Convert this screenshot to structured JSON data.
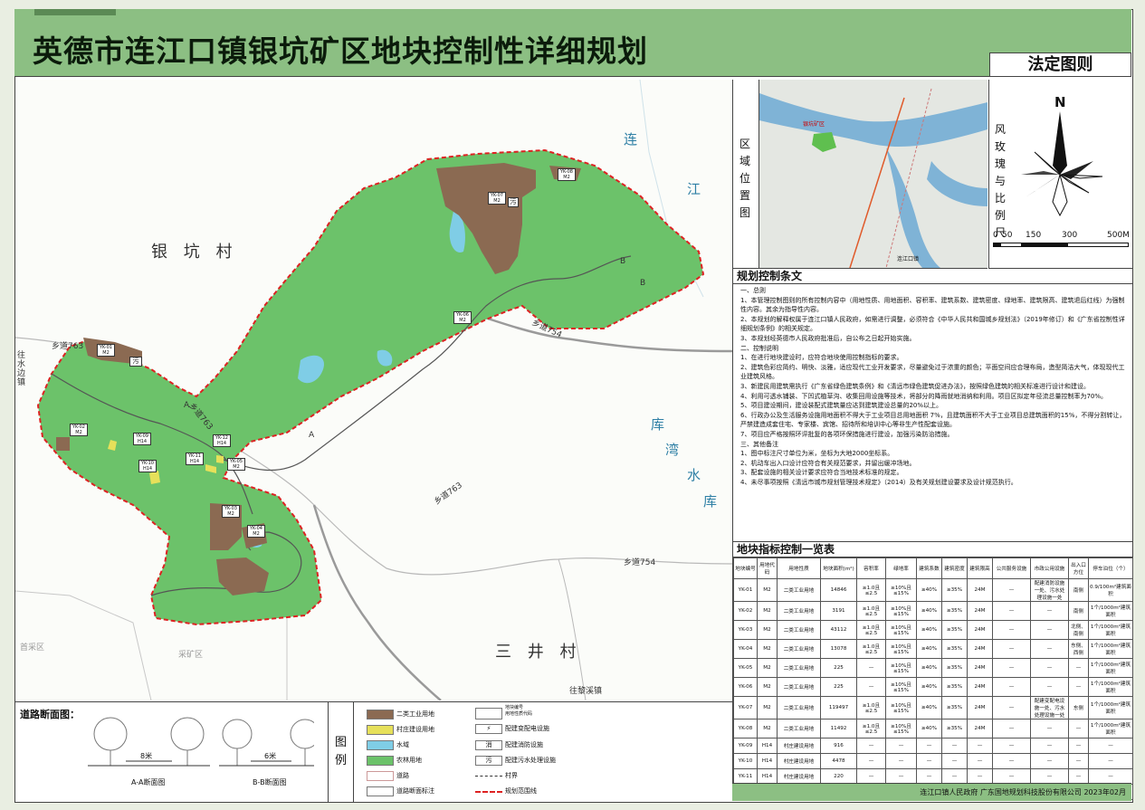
{
  "title": "英德市连江口镇银坑矿区地块控制性详细规划",
  "subtitle": "法定图则",
  "map": {
    "place_labels": [
      "银 坑 村",
      "三 井 村"
    ],
    "river_labels": [
      "连",
      "江",
      "库",
      "湾",
      "水",
      "库"
    ],
    "edge_labels": [
      "往水边镇",
      "首采区",
      "采矿区",
      "往黎溪镇"
    ],
    "road_labels": [
      "乡道763",
      "乡道763",
      "乡道754",
      "乡道763",
      "乡道754"
    ],
    "plot_labels": [
      {
        "code": "YK-01",
        "use": "M2"
      },
      {
        "code": "YK-02",
        "use": "M2"
      },
      {
        "code": "YK-03",
        "use": "M2"
      },
      {
        "code": "YK-04",
        "use": "M2"
      },
      {
        "code": "YK-05",
        "use": "M2"
      },
      {
        "code": "YK-06",
        "use": "M2"
      },
      {
        "code": "YK-07",
        "use": "M2"
      },
      {
        "code": "YK-08",
        "use": "M2"
      },
      {
        "code": "YK-09",
        "use": "H14"
      },
      {
        "code": "YK-10",
        "use": "H14"
      },
      {
        "code": "YK-11",
        "use": "H14"
      },
      {
        "code": "YK-12",
        "use": "H14"
      }
    ],
    "facility_badges": [
      "污",
      "污"
    ],
    "section_marks": [
      "A",
      "A",
      "B",
      "B"
    ]
  },
  "location_map": {
    "label": "区域位置图",
    "place_label": "银坑矿区",
    "town_label": "连江口镇"
  },
  "compass": {
    "label": "风玫瑰与比例尺",
    "north": "N",
    "scale_ticks": [
      "0",
      "50",
      "150",
      "300",
      "500M"
    ]
  },
  "provisions": {
    "heading": "规划控制条文",
    "lines": [
      "一、总则",
      "1、本管理控制图则的所有控制内容中（用地性质、用地面积、容积率、建筑系数、建筑密度、绿地率、建筑限高、建筑退后红线）为强制性内容。其余为指导性内容。",
      "2、本规划的解释权属于连江口镇人民政府，如需进行调整，必须符合《中华人民共和国城乡规划法》（2019年修订）和《广东省控制性详细规划条例》的相关规定。",
      "3、本规划经英德市人民政府批准后，自公布之日起开始实施。",
      "二、控制说明",
      "1、在进行地块建设时，应符合地块使用控制指标的要求。",
      "2、建筑色彩应简约、明快、淡雅，适应现代工业开发要求，尽量避免过于浓重的颜色；平面空间应合理布局，造型简洁大气，体现现代工业建筑风格。",
      "3、新建民用建筑需执行《广东省绿色建筑条例》和《清远市绿色建筑促进办法》，按照绿色建筑的相关标准进行设计和建设。",
      "4、利用可透水铺装、下凹式植草沟、收集回用设施等技术，将部分的降雨就地消纳和利用。项目区拟定年径流总量控制率为70%。",
      "5、项目建设期间，建设装配式建筑量应达到建筑建设总量的20%以上。",
      "6、行政办公及生活服务设施用地面积不得大于工业项目总用地面积 7%，且建筑面积不大于工业项目总建筑面积的15%，不得分割转让，严禁建造成套住宅、专家楼、宾馆、招待所和培训中心等非生产性配套设施。",
      "7、项目应严格按照环评批复的各项环保措施进行建设，加强污染防治措施。",
      "三、其他备注",
      "1、图中标注尺寸单位为米，坐标为大地2000坐标系。",
      "2、机动车出入口设计应符合有关规范要求，并留出缓冲场地。",
      "3、配套设施的相关设计要求应符合当地技术标准的规定。",
      "4、未尽事项按照《清远市城市规划管理技术规定》（2014）及有关规划建设要求及设计规范执行。"
    ]
  },
  "table": {
    "heading": "地块指标控制一览表",
    "columns": [
      "地块编号",
      "用地代码",
      "用地性质",
      "地块面积(m²)",
      "容积率",
      "绿地率",
      "建筑系数",
      "建筑密度",
      "建筑限高",
      "公共服务设施",
      "市政公用设施",
      "出入口方位",
      "停车泊位（个）"
    ],
    "rows": [
      [
        "YK-01",
        "M2",
        "二类工业用地",
        "14846",
        "≥1.0且≤2.5",
        "≥10%且≤15%",
        "≥40%",
        "≥35%",
        "24M",
        "—",
        "配建消防设施一处、污水处理设施一处",
        "南侧",
        "0.9/100m²建筑面积"
      ],
      [
        "YK-02",
        "M2",
        "二类工业用地",
        "3191",
        "≥1.0且≤2.5",
        "≥10%且≤15%",
        "≥40%",
        "≥35%",
        "24M",
        "—",
        "—",
        "南侧",
        "1个/1000m²建筑面积"
      ],
      [
        "YK-03",
        "M2",
        "二类工业用地",
        "43112",
        "≥1.0且≤2.5",
        "≥10%且≤15%",
        "≥40%",
        "≥35%",
        "24M",
        "—",
        "—",
        "北侧、南侧",
        "1个/1000m²建筑面积"
      ],
      [
        "YK-04",
        "M2",
        "二类工业用地",
        "13078",
        "≥1.0且≤2.5",
        "≥10%且≤15%",
        "≥40%",
        "≥35%",
        "24M",
        "—",
        "—",
        "东侧、西侧",
        "1个/1000m²建筑面积"
      ],
      [
        "YK-05",
        "M2",
        "二类工业用地",
        "225",
        "—",
        "≥10%且≤15%",
        "≥40%",
        "≥35%",
        "24M",
        "—",
        "—",
        "—",
        "1个/1000m²建筑面积"
      ],
      [
        "YK-06",
        "M2",
        "二类工业用地",
        "225",
        "—",
        "≥10%且≤15%",
        "≥40%",
        "≥35%",
        "24M",
        "—",
        "—",
        "—",
        "1个/1000m²建筑面积"
      ],
      [
        "YK-07",
        "M2",
        "二类工业用地",
        "119497",
        "≥1.0且≤2.5",
        "≥10%且≤15%",
        "≥40%",
        "≥35%",
        "24M",
        "—",
        "配建变配电设施一处、污水处理设施一处",
        "东侧",
        "1个/1000m²建筑面积"
      ],
      [
        "YK-08",
        "M2",
        "二类工业用地",
        "11492",
        "≥1.0且≤2.5",
        "≥10%且≤15%",
        "≥40%",
        "≥35%",
        "24M",
        "—",
        "—",
        "—",
        "1个/1000m²建筑面积"
      ],
      [
        "YK-09",
        "H14",
        "村庄建设用地",
        "916",
        "—",
        "—",
        "—",
        "—",
        "—",
        "—",
        "—",
        "—",
        "—"
      ],
      [
        "YK-10",
        "H14",
        "村庄建设用地",
        "4478",
        "—",
        "—",
        "—",
        "—",
        "—",
        "—",
        "—",
        "—",
        "—"
      ],
      [
        "YK-11",
        "H14",
        "村庄建设用地",
        "220",
        "—",
        "—",
        "—",
        "—",
        "—",
        "—",
        "—",
        "—",
        "—"
      ],
      [
        "YK-12",
        "H14",
        "村庄建设用地",
        "666",
        "—",
        "—",
        "—",
        "—",
        "—",
        "—",
        "—",
        "—",
        "—"
      ]
    ]
  },
  "footer": "连江口镇人民政府  广东国地规划科技股份有限公司  2023年02月",
  "road_section": {
    "heading": "道路断面图：",
    "sections": [
      {
        "width": "8米",
        "name": "A-A断面图"
      },
      {
        "width": "6米",
        "name": "B-B断面图"
      }
    ]
  },
  "legend": {
    "heading": "图例",
    "items": [
      {
        "label": "二类工业用地",
        "color": "#8b6a52"
      },
      {
        "label": "村庄建设用地",
        "color": "#e6e05a"
      },
      {
        "label": "水域",
        "color": "#7fcde6"
      },
      {
        "label": "农林用地",
        "color": "#6cc26a"
      },
      {
        "label": "道路",
        "color": "#ffffff"
      },
      {
        "label": "道路断面标注"
      }
    ],
    "items2": [
      {
        "label": "地块编号\n用地性质代码"
      },
      {
        "label": "配建变配电设施",
        "symbol": "⚡"
      },
      {
        "label": "配建消防设施",
        "symbol": "消"
      },
      {
        "label": "配建污水处理设施",
        "symbol": "污"
      },
      {
        "label": "村界"
      },
      {
        "label": "规划范围线"
      }
    ]
  }
}
